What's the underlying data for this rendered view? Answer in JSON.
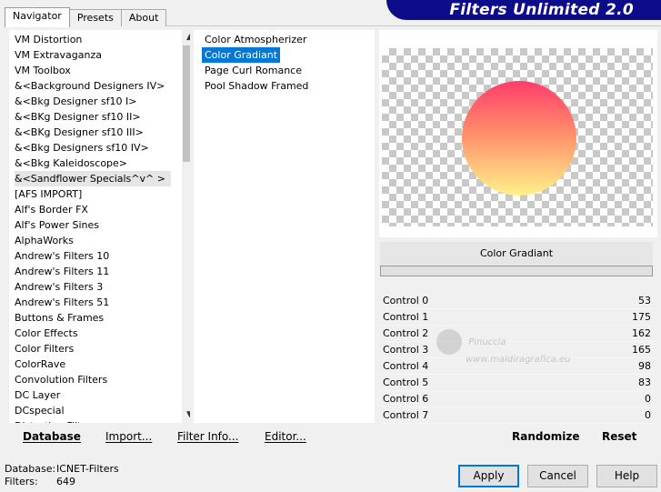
{
  "banner_title": "Filters Unlimited 2.0",
  "tabs": [
    {
      "label": "Navigator",
      "active": true
    },
    {
      "label": "Presets",
      "active": false
    },
    {
      "label": "About",
      "active": false
    }
  ],
  "categories": [
    "VM Distortion",
    "VM Extravaganza",
    "VM Toolbox",
    "&<Background Designers IV>",
    "&<Bkg Designer sf10 I>",
    "&<BKg Designer sf10 II>",
    "&<BKg Designer sf10 III>",
    "&<Bkg Designers sf10 IV>",
    "&<Bkg Kaleidoscope>",
    "&<Sandflower Specials^v^ >",
    "[AFS IMPORT]",
    "Alf's Border FX",
    "Alf's Power Sines",
    "AlphaWorks",
    "Andrew's Filters 10",
    "Andrew's Filters 11",
    "Andrew's Filters 3",
    "Andrew's Filters 51",
    "Buttons & Frames",
    "Color Effects",
    "Color Filters",
    "ColorRave",
    "Convolution Filters",
    "DC Layer",
    "DCspecial",
    "Distortion Filters"
  ],
  "selected_category": "&<Sandflower Specials^v^ >",
  "effects": [
    "Color Atmospherizer",
    "Color Gradiant",
    "Page Curl Romance",
    "Pool Shadow Framed"
  ],
  "selected_effect": "Color Gradiant",
  "effect_title": "Color Gradiant",
  "controls": [
    {
      "label": "Control 0",
      "value": "53"
    },
    {
      "label": "Control 1",
      "value": "175"
    },
    {
      "label": "Control 2",
      "value": "162"
    },
    {
      "label": "Control 3",
      "value": "165"
    },
    {
      "label": "Control 4",
      "value": "98"
    },
    {
      "label": "Control 5",
      "value": "83"
    },
    {
      "label": "Control 6",
      "value": "0"
    },
    {
      "label": "Control 7",
      "value": "0"
    }
  ],
  "watermark": {
    "line1": "Pinuccia",
    "line2": "www.maldiragrafica.eu"
  },
  "bottom_links": {
    "database": "Database",
    "import": "Import...",
    "filter_info": "Filter Info...",
    "editor": "Editor..."
  },
  "randomize": "Randomize",
  "reset": "Reset",
  "footer": {
    "database_label": "Database:",
    "database_value": "ICNET-Filters",
    "filters_label": "Filters:",
    "filters_value": "649"
  },
  "buttons": {
    "apply": "Apply",
    "cancel": "Cancel",
    "help": "Help"
  },
  "colors": {
    "accent": "#0078d7",
    "banner": "#0d0d8c",
    "gradient_top": "#ff3d6b",
    "gradient_bottom": "#fff18a"
  }
}
